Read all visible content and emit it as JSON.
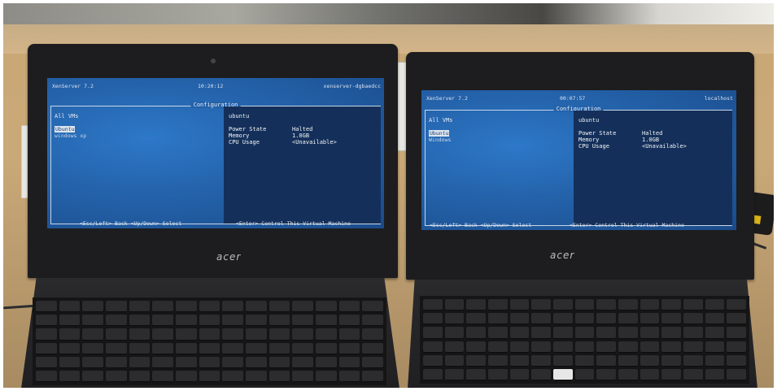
{
  "laptops": [
    {
      "header_left": "XenServer 7.2",
      "header_time": "10:20:12",
      "header_right": "xenserver-dgbaedcc",
      "config_title": "Configuration",
      "left_heading": "All VMs",
      "vms": [
        "Ubuntu",
        "windows xp"
      ],
      "vm_name": "ubuntu",
      "fields": [
        {
          "key": "Power State",
          "value": "Halted"
        },
        {
          "key": "Memory",
          "value": "1.0GB"
        },
        {
          "key": "CPU Usage",
          "value": "<Unavailable>"
        }
      ],
      "footer_left": "<Esc/Left> Back  <Up/Down> Select",
      "footer_right": "<Enter> Control This Virtual Machine",
      "brand": "acer"
    },
    {
      "header_left": "XenServer 7.2",
      "header_time": "00:07:57",
      "header_right": "localhost",
      "config_title": "Configuration",
      "left_heading": "All VMs",
      "vms": [
        "Ubuntu",
        "Windows"
      ],
      "vm_name": "ubuntu",
      "fields": [
        {
          "key": "Power State",
          "value": "Halted"
        },
        {
          "key": "Memory",
          "value": "1.0GB"
        },
        {
          "key": "CPU Usage",
          "value": "<Unavailable>"
        }
      ],
      "footer_left": "<Esc/Left> Back  <Up/Down> Select",
      "footer_right": "<Enter> Control This Virtual Machine",
      "brand": "acer"
    }
  ]
}
